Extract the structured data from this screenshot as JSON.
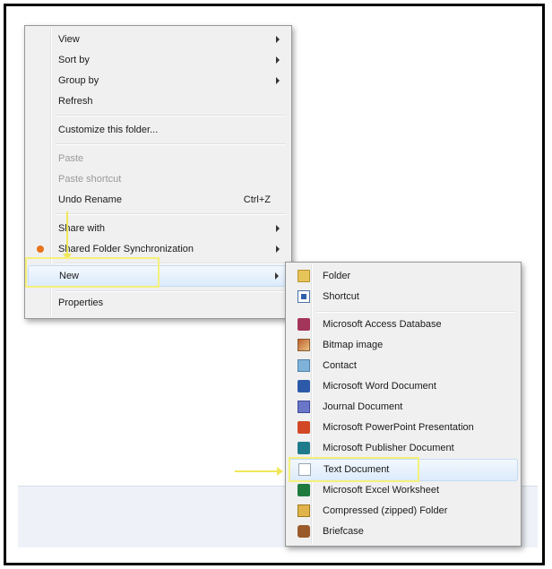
{
  "context_menu": {
    "items": [
      {
        "label": "View",
        "submenu": true
      },
      {
        "label": "Sort by",
        "submenu": true
      },
      {
        "label": "Group by",
        "submenu": true
      },
      {
        "label": "Refresh"
      },
      {
        "label": "Customize this folder..."
      },
      {
        "label": "Paste",
        "disabled": true
      },
      {
        "label": "Paste shortcut",
        "disabled": true
      },
      {
        "label": "Undo Rename",
        "shortcut": "Ctrl+Z"
      },
      {
        "label": "Share with",
        "submenu": true
      },
      {
        "label": "Shared Folder Synchronization",
        "submenu": true,
        "icon": "sync-icon"
      },
      {
        "label": "New",
        "submenu": true,
        "highlighted": true
      },
      {
        "label": "Properties"
      }
    ]
  },
  "new_submenu": {
    "items": [
      {
        "label": "Folder",
        "icon": "folder-icon"
      },
      {
        "label": "Shortcut",
        "icon": "shortcut-icon"
      },
      {
        "label": "Microsoft Access Database",
        "icon": "access-icon"
      },
      {
        "label": "Bitmap image",
        "icon": "bitmap-icon"
      },
      {
        "label": "Contact",
        "icon": "contact-icon"
      },
      {
        "label": "Microsoft Word Document",
        "icon": "word-icon"
      },
      {
        "label": "Journal Document",
        "icon": "journal-icon"
      },
      {
        "label": "Microsoft PowerPoint Presentation",
        "icon": "powerpoint-icon"
      },
      {
        "label": "Microsoft Publisher Document",
        "icon": "publisher-icon"
      },
      {
        "label": "Text Document",
        "icon": "text-document-icon",
        "highlighted": true
      },
      {
        "label": "Microsoft Excel Worksheet",
        "icon": "excel-icon"
      },
      {
        "label": "Compressed (zipped) Folder",
        "icon": "zip-folder-icon"
      },
      {
        "label": "Briefcase",
        "icon": "briefcase-icon"
      }
    ]
  },
  "colors": {
    "menu_bg": "#f0f0f0",
    "highlight": "#dcebfc",
    "annotation": "#f0e85a",
    "disabled_text": "#9a9a9a"
  }
}
